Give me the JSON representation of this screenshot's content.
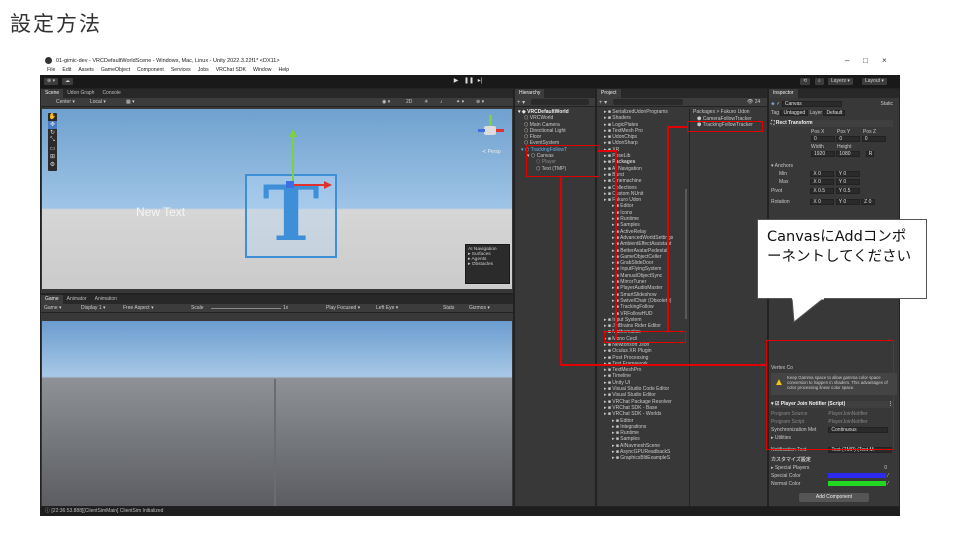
{
  "slide": {
    "title": "設定方法"
  },
  "window": {
    "title": "01-gimic-dev - VRCDefaultWorldScene - Windows, Mac, Linux - Unity 2022.3.22f1* <DX11>",
    "controls": [
      "–",
      "□",
      "×"
    ]
  },
  "menu": [
    "File",
    "Edit",
    "Assets",
    "GameObject",
    "Component",
    "Services",
    "Jobs",
    "VRChat SDK",
    "Window",
    "Help"
  ],
  "toolbar": {
    "layers": "Layers",
    "layout": "Layout"
  },
  "scene": {
    "tabs": [
      "Scene",
      "Udon Graph",
      "Console"
    ],
    "pivot": "Center",
    "space": "Local",
    "canvas_text": "New Text",
    "persp_label": "≺ Persp",
    "ai_nav": {
      "title": "AI Navigation",
      "items": [
        "Surfaces",
        "Agents",
        "Obstacles"
      ]
    }
  },
  "game": {
    "tabs": [
      "Game",
      "Animator",
      "Animation"
    ],
    "display": "Display 1",
    "aspect": "Free Aspect",
    "scale_label": "Scale",
    "scale_value": "1x",
    "play_focused": "Play Focused",
    "eye": "Left Eye",
    "stats": "Stats",
    "gizmos": "Gizmos"
  },
  "hierarchy": {
    "tab": "Hierarchy",
    "items": [
      {
        "label": "VRCDefaultWorld",
        "depth": 0,
        "selected": false
      },
      {
        "label": "VRCWorld",
        "depth": 1,
        "selected": false
      },
      {
        "label": "Main Camera",
        "depth": 1,
        "selected": false
      },
      {
        "label": "Directional Light",
        "depth": 1,
        "selected": false
      },
      {
        "label": "Floor",
        "depth": 1,
        "selected": false
      },
      {
        "label": "EventSystem",
        "depth": 1,
        "selected": false
      },
      {
        "label": "TrackingFollowT",
        "depth": 1,
        "selected": true
      },
      {
        "label": "Canvas",
        "depth": 2,
        "selected": false
      },
      {
        "label": "Player",
        "depth": 3,
        "selected": false
      },
      {
        "label": "Text (TMP)",
        "depth": 3,
        "selected": false
      }
    ]
  },
  "project": {
    "tab": "Project",
    "left_items": [
      "SerializedUdonPrograms",
      "Shaders",
      "LogicPlates",
      "TextMesh Pro",
      "UdonChips",
      "UdonSharp",
      "XR",
      "PoseLib",
      "Packages",
      "AI Navigation",
      "Burst",
      "Cinemachine",
      "Collections",
      "Custom NUnit",
      "Fukuro Udon",
      "Editor",
      "Icons",
      "Runtime",
      "Samples",
      "ActiveRelay",
      "AdvancedWorldSettings",
      "AmbientEffectAssistant",
      "BetterAvatarPedestal",
      "GameObjectCeller",
      "GrabSlideDoor",
      "InputFlyingSystem",
      "ManualObjectSync",
      "MirrorTuner",
      "PlayerAudioMaster",
      "SmartSlideshow",
      "SwivelChair (Obsolete)",
      "TrackingFollow",
      "VRFollowHUD",
      "Input System",
      "JetBrains Rider Editor",
      "Mathematics",
      "Mono Cecil",
      "Newtonsoft Json",
      "Oculus XR Plugin",
      "Post Processing",
      "Test Framework",
      "TextMeshPro",
      "Timeline",
      "Unity UI",
      "Visual Studio Code Editor",
      "Visual Studio Editor",
      "VRChat Package Resolver",
      "VRChat SDK - Base",
      "VRChat SDK - Worlds",
      "Editor",
      "Integrations",
      "Runtime",
      "Samples",
      "AINavmeshScene",
      "AsyncGPUReadbackS",
      "GraphicsBlitExampleS"
    ],
    "breadcrumb": "Packages > Fukuro Udon",
    "right_items": [
      "CameraFollowTracker",
      "TrackingFollowTracker"
    ],
    "count": "24"
  },
  "inspector": {
    "tab": "Inspector",
    "object": "Canvas",
    "static": "Static",
    "tag_label": "Tag",
    "tag": "Untagged",
    "layer_label": "Layer",
    "layer": "Default",
    "rect_transform": "Rect Transform",
    "pos": {
      "labels": [
        "Pos X",
        "Pos Y",
        "Pos Z"
      ],
      "values": [
        "0",
        "0",
        "0"
      ]
    },
    "size": {
      "labels": [
        "Width",
        "Height"
      ],
      "values": [
        "1920",
        "1080"
      ]
    },
    "anchors": {
      "label": "Anchors",
      "min_label": "Min",
      "min": [
        "X 0",
        "Y 0"
      ],
      "max_label": "Max",
      "max": [
        "X 0",
        "Y 0"
      ]
    },
    "pivot": {
      "label": "Pivot",
      "values": [
        "X 0.5",
        "Y 0.5"
      ]
    },
    "rotation": {
      "label": "Rotation",
      "values": [
        "X 0",
        "Y 0",
        "Z 0"
      ]
    },
    "vertex_label": "Vertex Co",
    "warning": "Keep Gamma space to allow gamma color space conversion to happen in shaders. This advantages of color processing linear color space.",
    "component": {
      "title": "Player Join Notifier (Script)",
      "program_source_label": "Program Source",
      "program_source": "PlayerJoinNotifier",
      "program_script_label": "Program Script",
      "program_script": "PlayerJoinNotifier",
      "sync_label": "Synchronization Met",
      "sync": "Continuous",
      "utilities": "Utilities",
      "notification_label": "Notification Text",
      "notification": "Text (TMP) (Text M",
      "custom_section": "カスタマイズ設定",
      "special_players_label": "Special Players",
      "special_players": "0",
      "special_color_label": "Special Color",
      "special_color": "#2a2af0",
      "normal_color_label": "Normal Color",
      "normal_color": "#22d822"
    },
    "add_component": "Add Component"
  },
  "callout": {
    "text": "CanvasにAddコンポーネントしてください"
  },
  "status": {
    "text": "[22:36:53.888][ClientSimMain] ClientSim Initialized"
  },
  "colors": {
    "accent_red": "#e00000",
    "selection": "#2c5d87"
  }
}
